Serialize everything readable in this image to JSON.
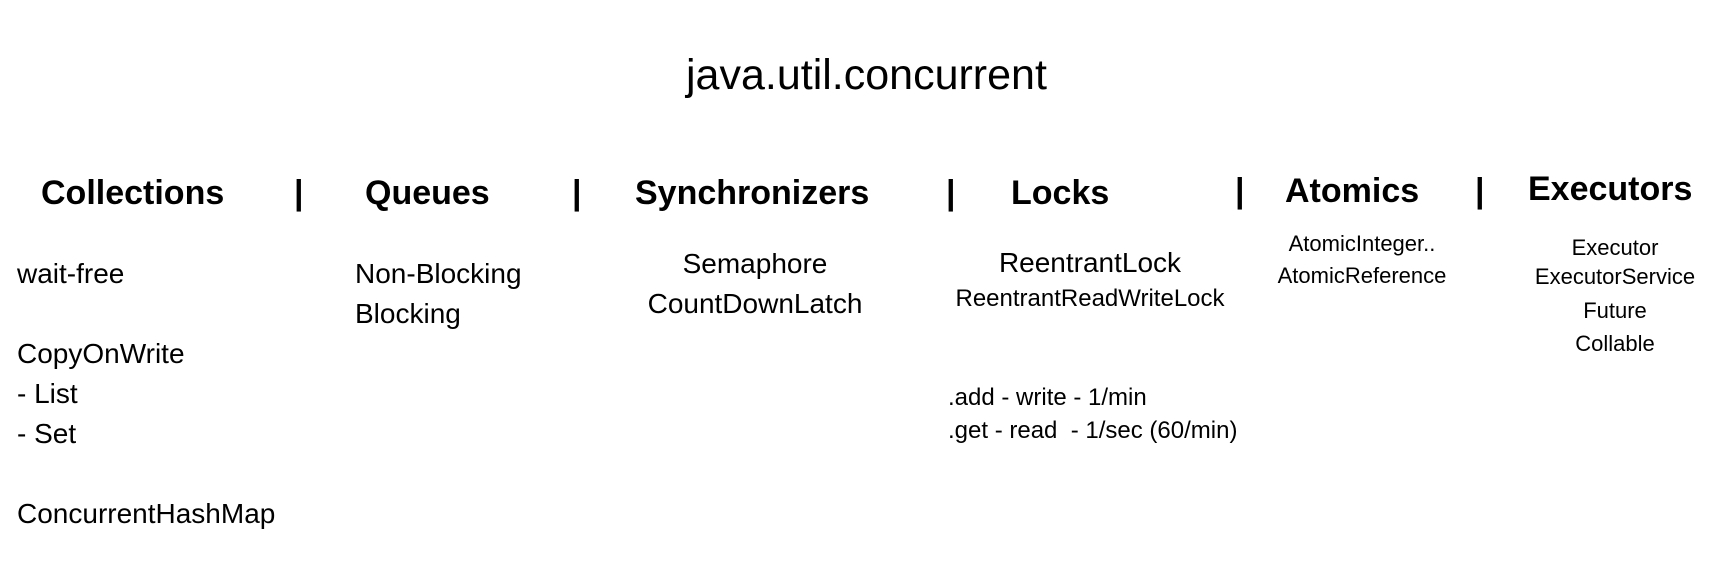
{
  "title": "java.util.concurrent",
  "separator": "|",
  "columns": {
    "collections": {
      "heading": "Collections",
      "items": [
        "wait-free",
        "CopyOnWrite",
        "- List",
        "- Set",
        "ConcurrentHashMap"
      ]
    },
    "queues": {
      "heading": "Queues",
      "items": [
        "Non-Blocking",
        "Blocking"
      ]
    },
    "synchronizers": {
      "heading": "Synchronizers",
      "items": [
        "Semaphore",
        "CountDownLatch"
      ]
    },
    "locks": {
      "heading": "Locks",
      "items": [
        "ReentrantLock",
        "ReentrantReadWriteLock"
      ],
      "notes": [
        ".add - write - 1/min",
        ".get - read  - 1/sec (60/min)"
      ]
    },
    "atomics": {
      "heading": "Atomics",
      "items": [
        "AtomicInteger..",
        "AtomicReference"
      ]
    },
    "executors": {
      "heading": "Executors",
      "items": [
        "Executor",
        "ExecutorService",
        "Future",
        "Collable"
      ]
    }
  }
}
